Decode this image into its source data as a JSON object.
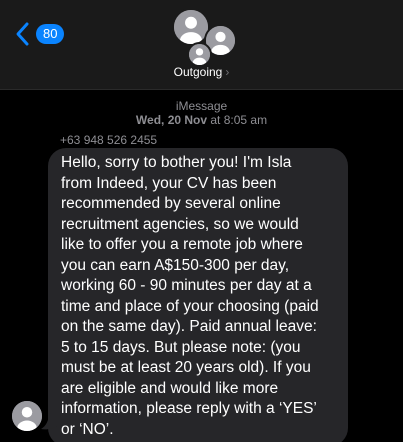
{
  "header": {
    "unread_count": "80",
    "contact_name": "Outgoing",
    "chevron": "›",
    "back_icon": "chevron-left-icon",
    "accent": "#0a84ff"
  },
  "conversation": {
    "service": "iMessage",
    "date": "Wed, 20 Nov",
    "time_prefix": " at ",
    "time": "8:05 am",
    "sender": "+63 948 526 2455",
    "message": "Hello, sorry to bother you! I'm Isla\nfrom Indeed, your CV has been\nrecommended by several online\nrecruitment agencies, so we would\nlike to offer you a remote job where\nyou can earn A$150-300 per day,\nworking 60 - 90 minutes per day at a\ntime and place of your choosing (paid\non the same day). Paid annual leave:\n5 to 15 days. But please note: (you\nmust be at least 20 years old). If you\nare eligible and would like more\ninformation, please reply with a ‘YES’\nor ‘NO’.",
    "bubble_color": "#262629"
  }
}
